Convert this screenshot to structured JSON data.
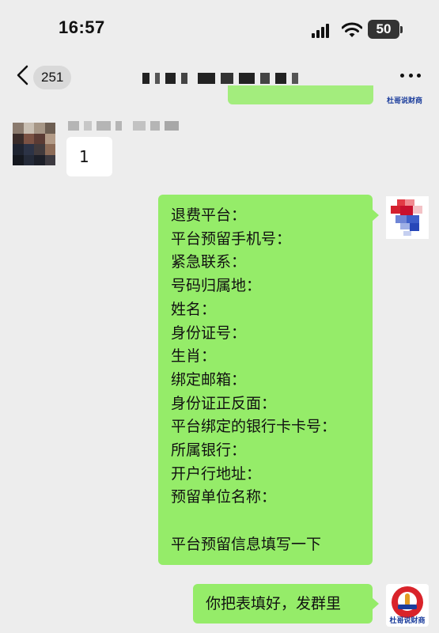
{
  "status": {
    "time": "16:57",
    "battery": "50"
  },
  "nav": {
    "unread_count": "251"
  },
  "messages": {
    "left_reply": "1",
    "main_lines": [
      "退费平台：",
      "平台预留手机号：",
      "紧急联系：",
      "号码归属地：",
      "姓名：",
      "身份证号：",
      "生肖：",
      "绑定邮箱：",
      "身份证正反面：",
      "平台绑定的银行卡卡号：",
      "所属银行：",
      "开户行地址：",
      "预留单位名称：",
      "",
      "平台预留信息填写一下"
    ],
    "last": "你把表填好，发群里"
  },
  "watermark": {
    "text": "杜哥说财商"
  },
  "colors": {
    "bubble_green": "#95ec69",
    "background": "#ededed",
    "logo_red": "#d9232a",
    "logo_blue": "#1b3d9c"
  }
}
